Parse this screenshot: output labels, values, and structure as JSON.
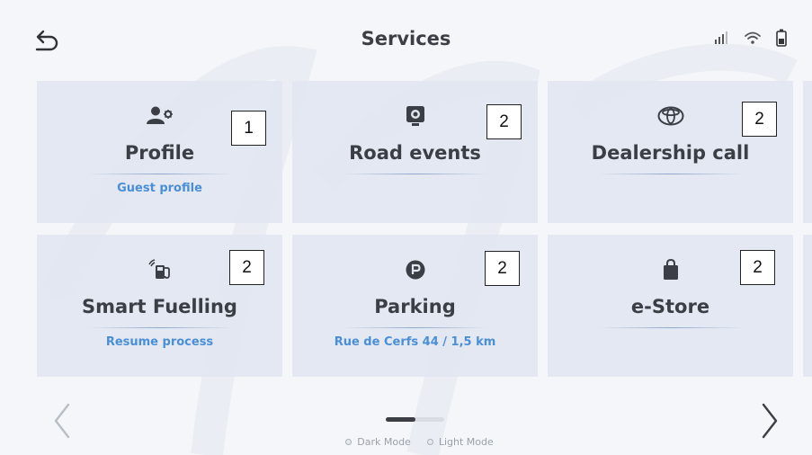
{
  "header": {
    "title": "Services",
    "back_icon": "back-arrow-icon",
    "status_icons": [
      "signal-icon",
      "wifi-icon",
      "battery-icon"
    ]
  },
  "tiles": [
    {
      "title": "Profile",
      "subtitle": "Guest profile",
      "icon": "user-settings-icon",
      "badge": "1"
    },
    {
      "title": "Road events",
      "subtitle": "",
      "icon": "dashcam-icon",
      "badge": "2"
    },
    {
      "title": "Dealership call",
      "subtitle": "",
      "icon": "toyota-logo-icon",
      "badge": "2"
    },
    {
      "title": "Smart Fuelling",
      "subtitle": "Resume process",
      "icon": "fuel-pump-icon",
      "badge": "2"
    },
    {
      "title": "Parking",
      "subtitle": "Rue de Cerfs 44 / 1,5 km",
      "icon": "parking-icon",
      "badge": "2"
    },
    {
      "title": "e-Store",
      "subtitle": "",
      "icon": "shopping-bag-icon",
      "badge": "2"
    }
  ],
  "pager": {
    "current": 1,
    "total": 2
  },
  "modes": {
    "dark": "Dark Mode",
    "light": "Light Mode"
  },
  "colors": {
    "text": "#3b3f45",
    "accent": "#4a8fd6",
    "tile": "#e0e6f0"
  }
}
